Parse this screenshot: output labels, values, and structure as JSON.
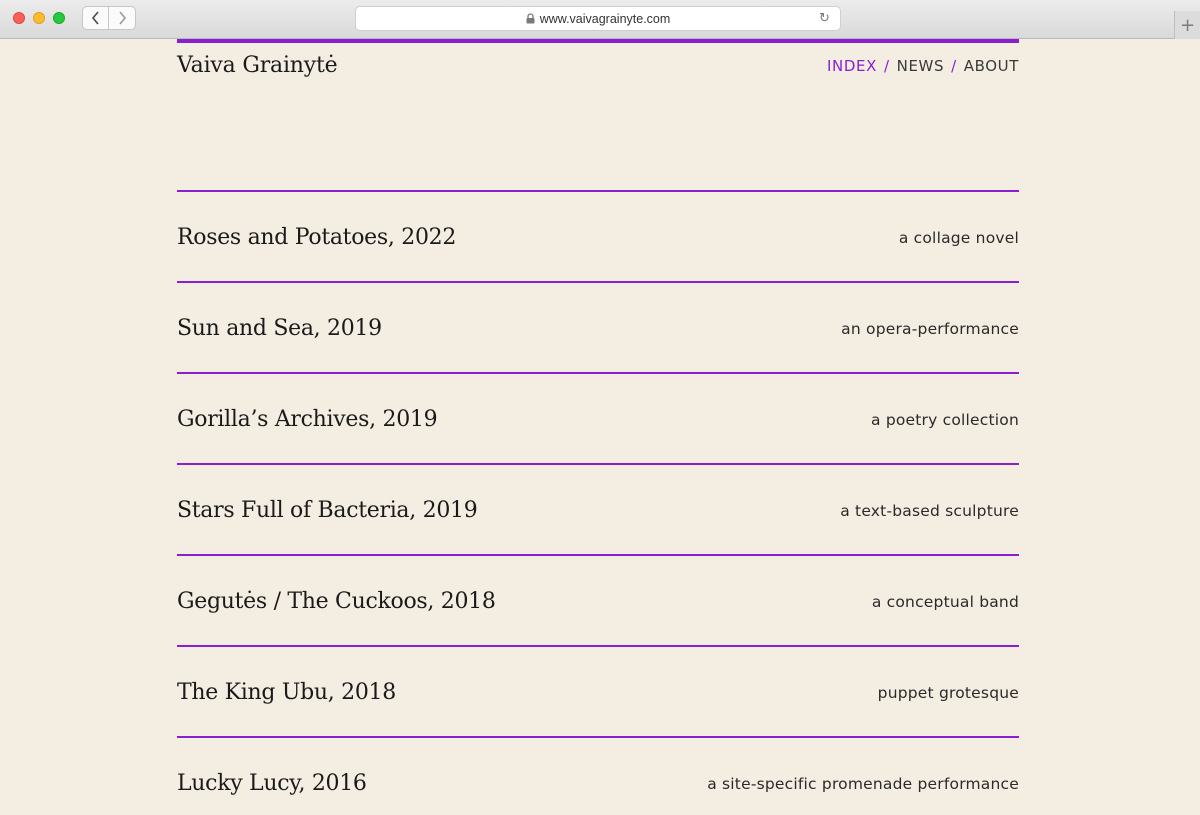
{
  "browser": {
    "url": "www.vaivagrainyte.com",
    "back_icon": "chevron-left-icon",
    "forward_icon": "chevron-right-icon",
    "reload_icon": "reload-icon",
    "new_tab_icon": "plus-icon",
    "new_tab_label": "+"
  },
  "site": {
    "title": "Vaiva Grainytė",
    "accent_color": "#8a1fd1",
    "background_color": "#f4ede1"
  },
  "nav": {
    "items": [
      {
        "label": "INDEX",
        "active": true
      },
      {
        "label": "NEWS",
        "active": false
      },
      {
        "label": "ABOUT",
        "active": false
      }
    ],
    "separator": "/"
  },
  "works": [
    {
      "title": "Roses and Potatoes, 2022",
      "kind": "a collage novel"
    },
    {
      "title": "Sun and Sea, 2019",
      "kind": "an opera-performance"
    },
    {
      "title": "Gorilla’s Archives, 2019",
      "kind": "a poetry collection"
    },
    {
      "title": "Stars Full of Bacteria, 2019",
      "kind": "a text-based sculpture"
    },
    {
      "title": "Gegutės / The Cuckoos, 2018",
      "kind": "a conceptual band"
    },
    {
      "title": "The King Ubu, 2018",
      "kind": "puppet grotesque"
    },
    {
      "title": "Lucky Lucy, 2016",
      "kind": "a site-specific promenade performance"
    }
  ]
}
